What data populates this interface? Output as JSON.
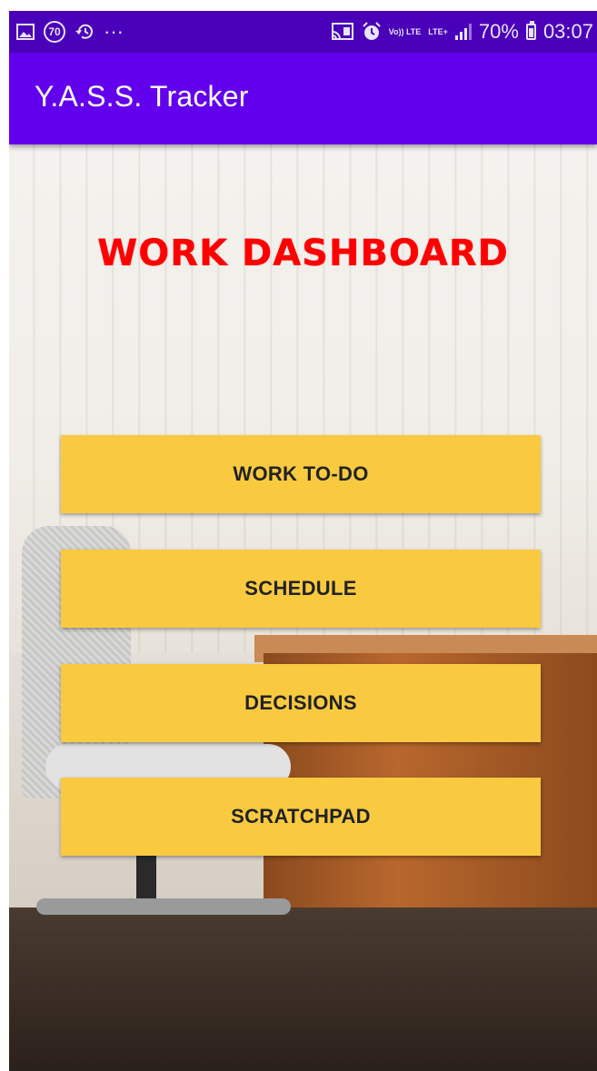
{
  "status_bar": {
    "left_icons": [
      "image-icon",
      "data-saver-70-icon",
      "history-icon",
      "more-dots-icon"
    ],
    "notification_count": "70",
    "more": "···",
    "right_icons": [
      "cast-icon",
      "alarm-icon",
      "volte-icon",
      "lte-plus-icon",
      "signal-icon",
      "battery-icon"
    ],
    "vo_label": "Vo)) LTE",
    "lte_label": "LTE+",
    "battery_percent": "70%",
    "time": "03:07"
  },
  "app_bar": {
    "title": "Y.A.S.S. Tracker",
    "color": "#6200ee"
  },
  "main": {
    "heading": "WORK DASHBOARD",
    "heading_color": "#ff0000",
    "buttons": [
      {
        "label": "WORK TO-DO"
      },
      {
        "label": "SCHEDULE"
      },
      {
        "label": "DECISIONS"
      },
      {
        "label": "SCRATCHPAD"
      }
    ],
    "button_color": "#f9ca40"
  }
}
